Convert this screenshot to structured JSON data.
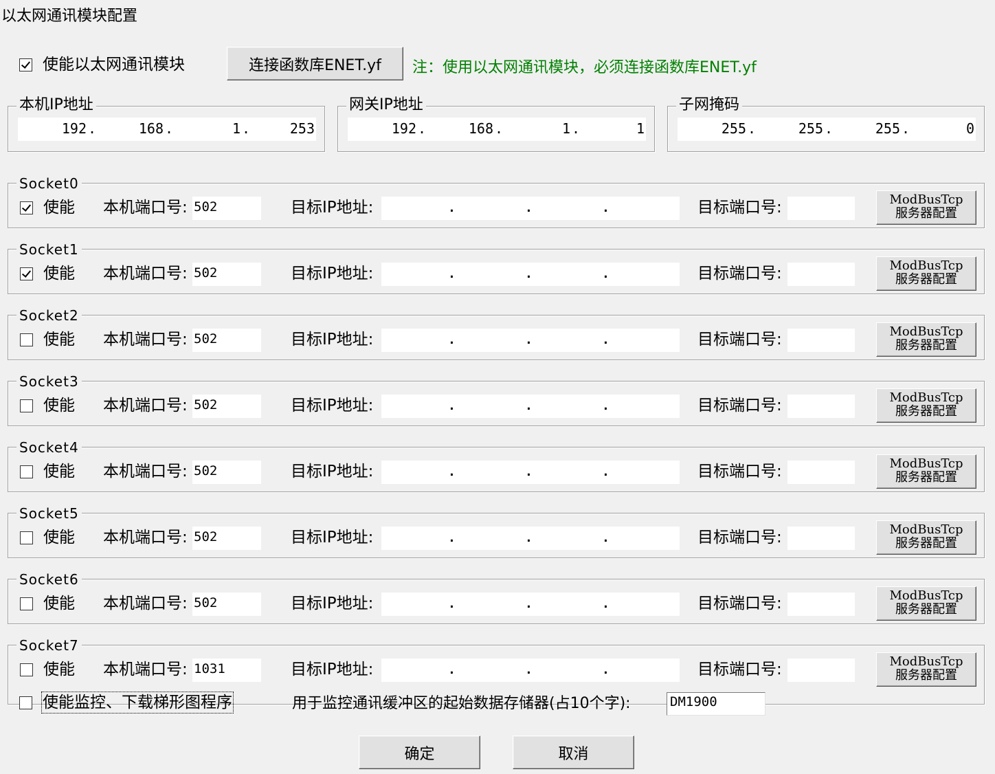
{
  "window": {
    "title": "以太网通讯模块配置"
  },
  "enable_module": {
    "label": "使能以太网通讯模块",
    "checked": true
  },
  "connect_button": {
    "label": "连接函数库ENET.yf"
  },
  "note": "注：使用以太网通讯模块，必须连接函数库ENET.yf",
  "colors": {
    "note": "#008000",
    "background": "#f0f0f0"
  },
  "local_ip": {
    "label": "本机IP地址",
    "octets": [
      "192",
      "168",
      "1",
      "253"
    ]
  },
  "gateway_ip": {
    "label": "网关IP地址",
    "octets": [
      "192",
      "168",
      "1",
      "1"
    ]
  },
  "subnet_mask": {
    "label": "子网掩码",
    "octets": [
      "255",
      "255",
      "255",
      "0"
    ]
  },
  "socket_labels": {
    "enable": "使能",
    "local_port": "本机端口号:",
    "target_ip": "目标IP地址:",
    "target_port": "目标端口号:",
    "modbus_line1": "ModBusTcp",
    "modbus_line2": "服务器配置"
  },
  "sockets": [
    {
      "name": "Socket0",
      "enabled": true,
      "local_port": "502",
      "target_ip": "",
      "target_port": ""
    },
    {
      "name": "Socket1",
      "enabled": true,
      "local_port": "502",
      "target_ip": "",
      "target_port": ""
    },
    {
      "name": "Socket2",
      "enabled": false,
      "local_port": "502",
      "target_ip": "",
      "target_port": ""
    },
    {
      "name": "Socket3",
      "enabled": false,
      "local_port": "502",
      "target_ip": "",
      "target_port": ""
    },
    {
      "name": "Socket4",
      "enabled": false,
      "local_port": "502",
      "target_ip": "",
      "target_port": ""
    },
    {
      "name": "Socket5",
      "enabled": false,
      "local_port": "502",
      "target_ip": "",
      "target_port": ""
    },
    {
      "name": "Socket6",
      "enabled": false,
      "local_port": "502",
      "target_ip": "",
      "target_port": ""
    },
    {
      "name": "Socket7",
      "enabled": false,
      "local_port": "1031",
      "target_ip": "",
      "target_port": ""
    }
  ],
  "monitor": {
    "label": "使能监控、下载梯形图程序",
    "checked": false,
    "buffer_label": "用于监控通讯缓冲区的起始数据存储器(占10个字):",
    "buffer_value": "DM1900"
  },
  "buttons": {
    "ok": "确定",
    "cancel": "取消"
  }
}
